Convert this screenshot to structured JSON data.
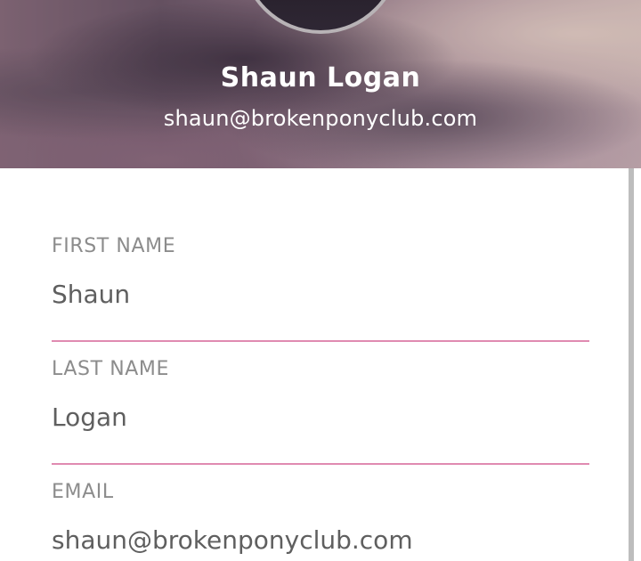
{
  "profile": {
    "name": "Shaun Logan",
    "email": "shaun@brokenponyclub.com"
  },
  "form": {
    "first_name": {
      "label": "FIRST NAME",
      "value": "Shaun"
    },
    "last_name": {
      "label": "LAST NAME",
      "value": "Logan"
    },
    "email": {
      "label": "EMAIL",
      "value": "shaun@brokenponyclub.com"
    }
  },
  "colors": {
    "accent_line": "#e08bb1",
    "label_text": "#8c8c8c",
    "value_text": "#5f5f5f",
    "header_text": "#ffffff"
  }
}
